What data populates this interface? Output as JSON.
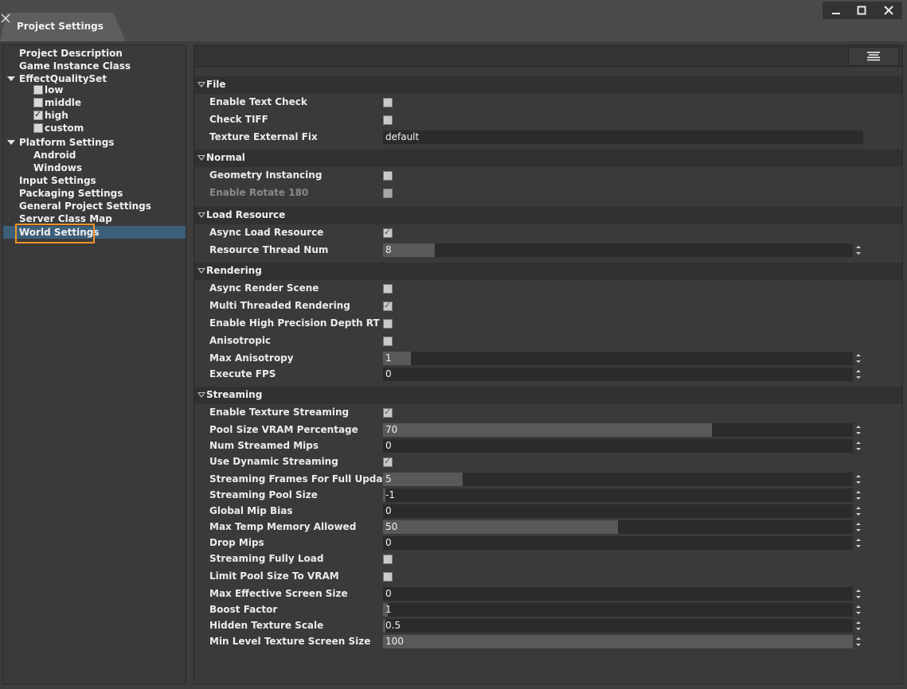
{
  "window": {
    "tab_title": "Project Settings",
    "controls": [
      "minimize",
      "maximize",
      "close"
    ]
  },
  "sidebar": {
    "items": [
      {
        "label": "Project Description"
      },
      {
        "label": "Game Instance Class"
      },
      {
        "label": "EffectQualitySet",
        "expanded": true,
        "children": [
          {
            "label": "low",
            "checked": false
          },
          {
            "label": "middle",
            "checked": false
          },
          {
            "label": "high",
            "checked": true
          },
          {
            "label": "custom",
            "checked": false
          }
        ]
      },
      {
        "label": "Platform Settings",
        "expanded": true,
        "children": [
          {
            "label": "Android"
          },
          {
            "label": "Windows"
          }
        ]
      },
      {
        "label": "Input Settings"
      },
      {
        "label": "Packaging Settings"
      },
      {
        "label": "General Project Settings"
      },
      {
        "label": "Server Class Map"
      },
      {
        "label": "World Settings",
        "selected": true
      }
    ]
  },
  "sections": [
    {
      "title": "File",
      "props": [
        {
          "label": "Enable Text Check",
          "type": "checkbox",
          "checked": false
        },
        {
          "label": "Check TIFF",
          "type": "checkbox",
          "checked": false
        },
        {
          "label": "Texture External Fix",
          "type": "text",
          "value": "default"
        }
      ]
    },
    {
      "title": "Normal",
      "props": [
        {
          "label": "Geometry Instancing",
          "type": "checkbox",
          "checked": false
        },
        {
          "label": "Enable Rotate 180",
          "type": "checkbox",
          "checked": false,
          "disabled": true
        }
      ]
    },
    {
      "title": "Load Resource",
      "props": [
        {
          "label": "Async Load Resource",
          "type": "checkbox",
          "checked": true
        },
        {
          "label": "Resource Thread Num",
          "type": "number",
          "value": "8",
          "fill": 0.11
        }
      ]
    },
    {
      "title": "Rendering",
      "props": [
        {
          "label": "Async Render Scene",
          "type": "checkbox",
          "checked": false
        },
        {
          "label": "Multi Threaded Rendering",
          "type": "checkbox",
          "checked": true
        },
        {
          "label": "Enable High Precision Depth RT",
          "type": "checkbox",
          "checked": false
        },
        {
          "label": "Anisotropic",
          "type": "checkbox",
          "checked": false
        },
        {
          "label": "Max Anisotropy",
          "type": "number",
          "value": "1",
          "fill": 0.06
        },
        {
          "label": "Execute FPS",
          "type": "number",
          "value": "0",
          "fill": 0
        }
      ]
    },
    {
      "title": "Streaming",
      "props": [
        {
          "label": "Enable Texture Streaming",
          "type": "checkbox",
          "checked": true
        },
        {
          "label": "Pool Size VRAM Percentage",
          "type": "number",
          "value": "70",
          "fill": 0.7
        },
        {
          "label": "Num Streamed Mips",
          "type": "number",
          "value": "0",
          "fill": 0
        },
        {
          "label": "Use Dynamic Streaming",
          "type": "checkbox",
          "checked": true
        },
        {
          "label": "Streaming Frames For Full Update",
          "type": "number",
          "value": "5",
          "fill": 0.17
        },
        {
          "label": "Streaming Pool Size",
          "type": "number",
          "value": "-1",
          "fill": 0.005
        },
        {
          "label": "Global Mip Bias",
          "type": "number",
          "value": "0",
          "fill": 0
        },
        {
          "label": "Max Temp Memory Allowed",
          "type": "number",
          "value": "50",
          "fill": 0.5
        },
        {
          "label": "Drop Mips",
          "type": "number",
          "value": "0",
          "fill": 0
        },
        {
          "label": "Streaming Fully Load",
          "type": "checkbox",
          "checked": false
        },
        {
          "label": "Limit Pool Size To VRAM",
          "type": "checkbox",
          "checked": false
        },
        {
          "label": "Max Effective Screen Size",
          "type": "number",
          "value": "0",
          "fill": 0
        },
        {
          "label": "Boost Factor",
          "type": "number",
          "value": "1",
          "fill": 0.01
        },
        {
          "label": "Hidden Texture Scale",
          "type": "number",
          "value": "0.5",
          "fill": 0.005
        },
        {
          "label": "Min Level Texture Screen Size",
          "type": "number",
          "value": "100",
          "fill": 1.0
        }
      ]
    }
  ],
  "colors": {
    "background": "#3d3d3d",
    "panel": "#3a3a3a",
    "section_header": "#313131",
    "field": "#2b2b2b",
    "field_fill": "#595959",
    "selection": "#3c5f7a",
    "highlight_box": "#f0932b"
  }
}
